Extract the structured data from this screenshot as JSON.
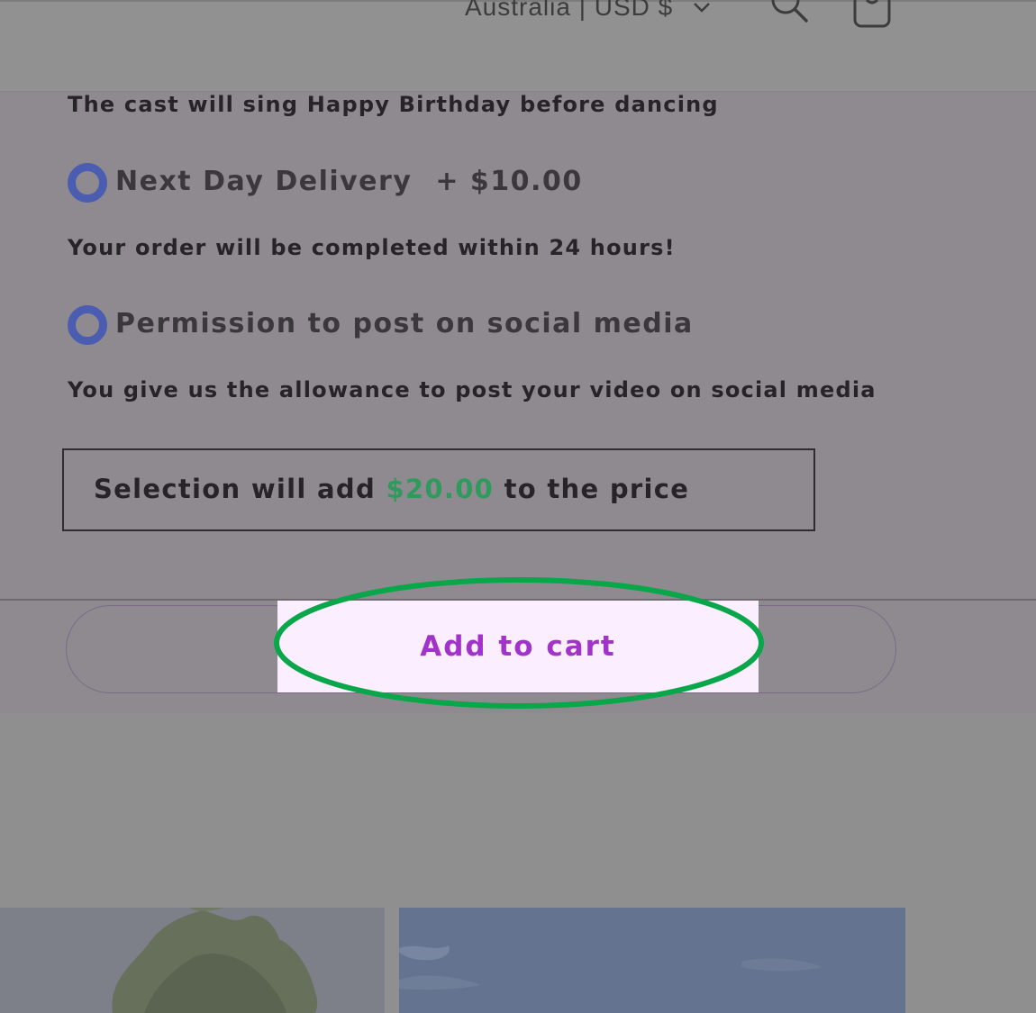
{
  "header": {
    "locale_label": "Australia | USD $",
    "icons": [
      "chevron-down-icon",
      "search-icon",
      "cart-icon"
    ]
  },
  "options": {
    "birthday_description": "The cast will sing Happy Birthday before dancing",
    "next_day": {
      "label": "Next Day Delivery",
      "price": "+ $10.00",
      "description": "Your order will be completed within 24 hours!"
    },
    "social_media": {
      "label": "Permission to post on social media",
      "description": "You give us the allowance to post your video on social media"
    }
  },
  "summary": {
    "prefix": "Selection will add",
    "amount": "$20.00",
    "suffix": "to the price"
  },
  "cart": {
    "button_label": "Add to cart"
  },
  "colors": {
    "radio_accent": "#4b5db0",
    "price_green": "#2e9a5c",
    "cart_text": "#a233c9",
    "cart_highlight_bg": "#fbeefe",
    "annotation_ring": "#0aa64a"
  }
}
